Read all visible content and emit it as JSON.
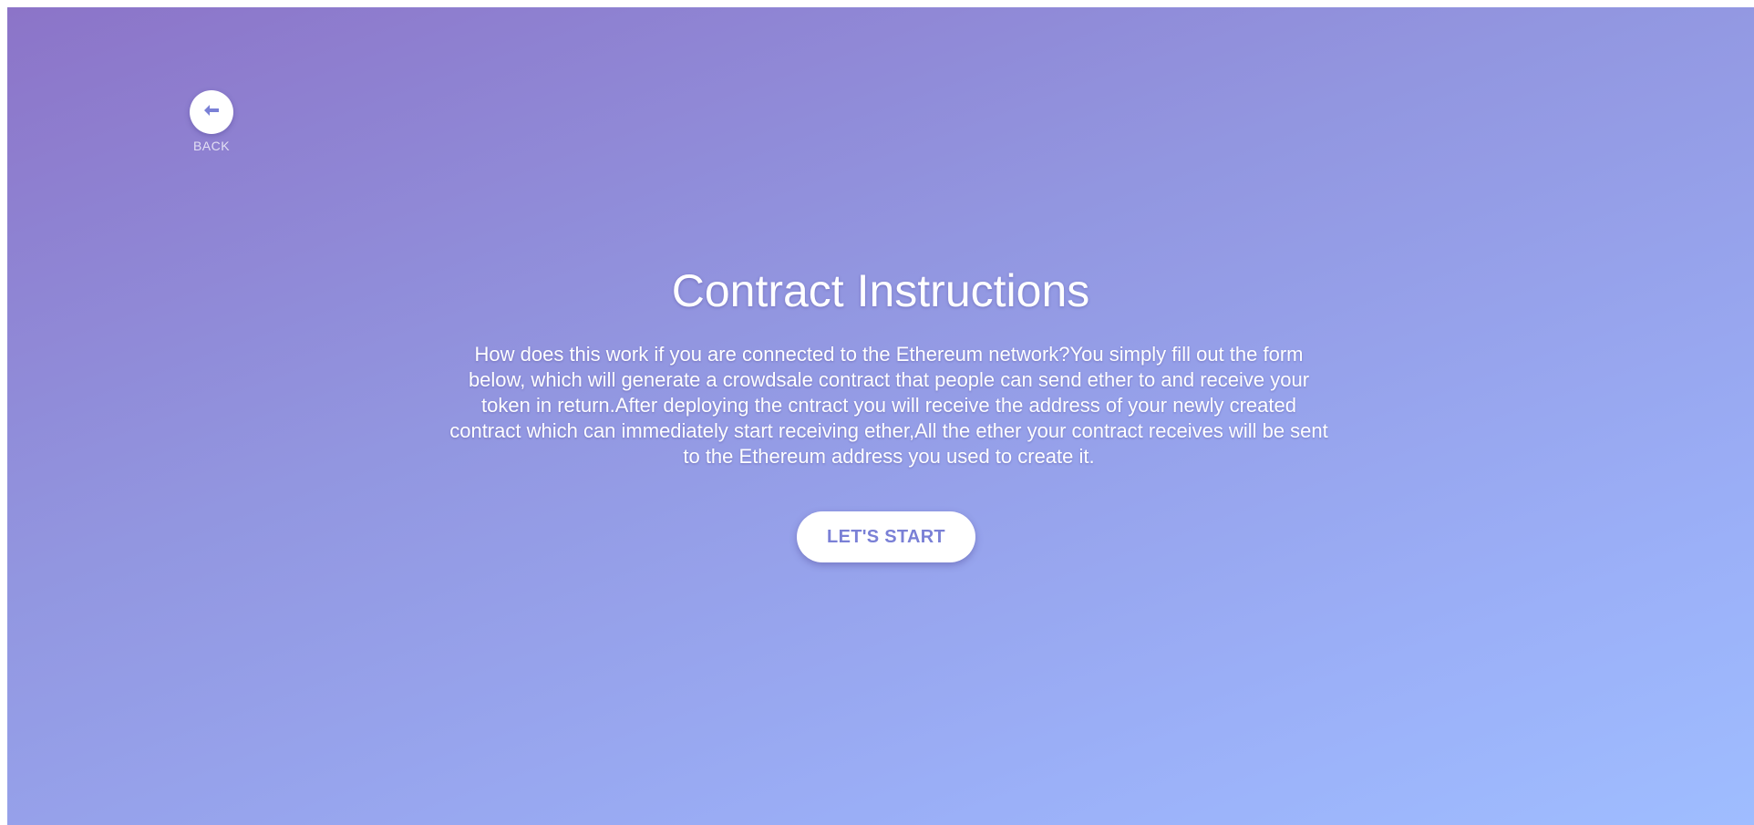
{
  "back": {
    "label": "BACK",
    "icon": "arrow-left-icon"
  },
  "content": {
    "title": "Contract Instructions",
    "description": "How does this work if you are connected to the Ethereum network?You simply fill out the form below, which will generate a crowdsale contract that people can send ether to and receive your token in return.After deploying the cntract you will receive the address of your newly created contract which can immediately start receiving ether,All the ether your contract receives will be sent to the Ethereum address you used to create it."
  },
  "actions": {
    "start_label": "LET'S START"
  },
  "colors": {
    "gradient_start": "#8c74c8",
    "gradient_end": "#9fbdff",
    "accent": "#7a80d6",
    "text": "#ffffff"
  }
}
